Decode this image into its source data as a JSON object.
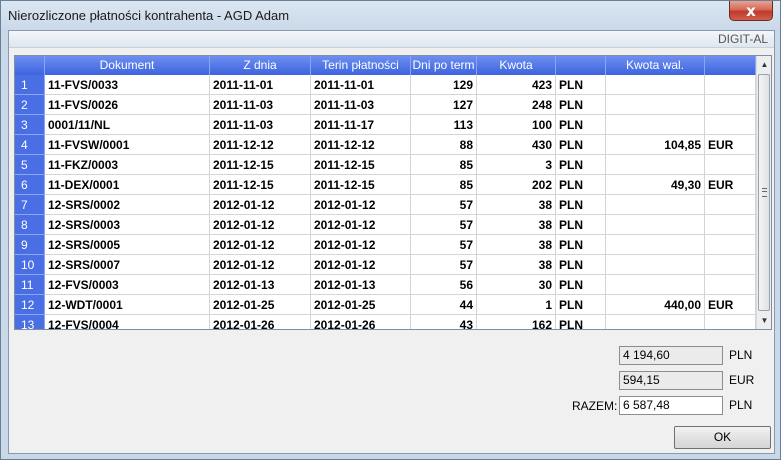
{
  "window": {
    "title": "Nierozliczone płatności kontrahenta - AGD Adam",
    "close_glyph": "x"
  },
  "brand": "DIGIT-AL",
  "table": {
    "columns": [
      "Dokument",
      "Z dnia",
      "Terin płatności",
      "Dni po term",
      "Kwota",
      "",
      "Kwota wal.",
      ""
    ],
    "rows": [
      [
        "1",
        "11-FVS/0033",
        "2011-11-01",
        "2011-11-01",
        "129",
        "423",
        "PLN",
        "",
        ""
      ],
      [
        "2",
        "11-FVS/0026",
        "2011-11-03",
        "2011-11-03",
        "127",
        "248",
        "PLN",
        "",
        ""
      ],
      [
        "3",
        "0001/11/NL",
        "2011-11-03",
        "2011-11-17",
        "113",
        "100",
        "PLN",
        "",
        ""
      ],
      [
        "4",
        "11-FVSW/0001",
        "2011-12-12",
        "2011-12-12",
        "88",
        "430",
        "PLN",
        "104,85",
        "EUR"
      ],
      [
        "5",
        "11-FKZ/0003",
        "2011-12-15",
        "2011-12-15",
        "85",
        "3",
        "PLN",
        "",
        ""
      ],
      [
        "6",
        "11-DEX/0001",
        "2011-12-15",
        "2011-12-15",
        "85",
        "202",
        "PLN",
        "49,30",
        "EUR"
      ],
      [
        "7",
        "12-SRS/0002",
        "2012-01-12",
        "2012-01-12",
        "57",
        "38",
        "PLN",
        "",
        ""
      ],
      [
        "8",
        "12-SRS/0003",
        "2012-01-12",
        "2012-01-12",
        "57",
        "38",
        "PLN",
        "",
        ""
      ],
      [
        "9",
        "12-SRS/0005",
        "2012-01-12",
        "2012-01-12",
        "57",
        "38",
        "PLN",
        "",
        ""
      ],
      [
        "10",
        "12-SRS/0007",
        "2012-01-12",
        "2012-01-12",
        "57",
        "38",
        "PLN",
        "",
        ""
      ],
      [
        "11",
        "12-FVS/0003",
        "2012-01-13",
        "2012-01-13",
        "56",
        "30",
        "PLN",
        "",
        ""
      ],
      [
        "12",
        "12-WDT/0001",
        "2012-01-25",
        "2012-01-25",
        "44",
        "1",
        "PLN",
        "440,00",
        "EUR"
      ],
      [
        "13",
        "12-FVS/0004",
        "2012-01-26",
        "2012-01-26",
        "43",
        "162",
        "PLN",
        "",
        ""
      ]
    ]
  },
  "scrollbar": {
    "up_glyph": "▲",
    "down_glyph": "▼"
  },
  "totals": {
    "pln_value": "4 194,60",
    "pln_currency": "PLN",
    "eur_value": "594,15",
    "eur_currency": "EUR",
    "razem_label": "RAZEM:",
    "razem_value": "6 587,48",
    "razem_currency": "PLN"
  },
  "ok_label": "OK"
}
